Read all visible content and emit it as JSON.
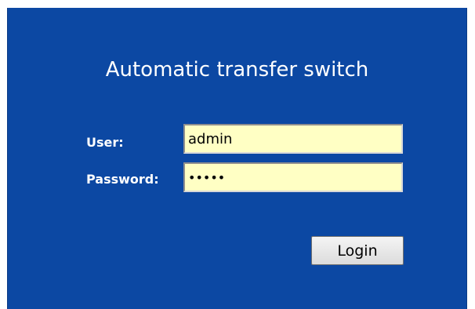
{
  "panel": {
    "background_color": "#0c48a3"
  },
  "login_form": {
    "title": "Automatic transfer switch",
    "user_label": "User:",
    "user_value": "admin",
    "password_label": "Password:",
    "password_value": "•••••",
    "login_button_label": "Login",
    "field_background_color": "#ffffc4"
  }
}
